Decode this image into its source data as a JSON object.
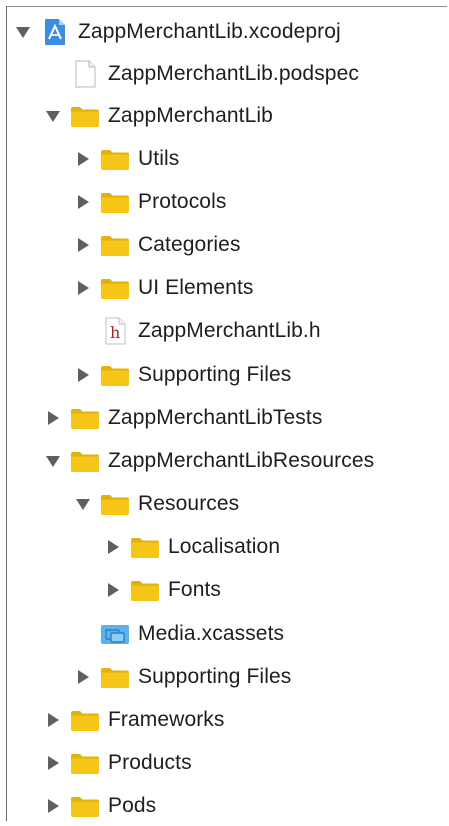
{
  "navigator": {
    "rows": [
      {
        "label": "ZappMerchantLib.xcodeproj",
        "icon": "xcode-project-icon",
        "disclosure": "expanded"
      },
      {
        "label": "ZappMerchantLib.podspec",
        "icon": "document-icon",
        "disclosure": "none"
      },
      {
        "label": "ZappMerchantLib",
        "icon": "folder-icon",
        "disclosure": "expanded"
      },
      {
        "label": "Utils",
        "icon": "folder-icon",
        "disclosure": "collapsed"
      },
      {
        "label": "Protocols",
        "icon": "folder-icon",
        "disclosure": "collapsed"
      },
      {
        "label": "Categories",
        "icon": "folder-icon",
        "disclosure": "collapsed"
      },
      {
        "label": "UI Elements",
        "icon": "folder-icon",
        "disclosure": "collapsed"
      },
      {
        "label": "ZappMerchantLib.h",
        "icon": "header-file-icon",
        "icon_glyph": "h",
        "disclosure": "none"
      },
      {
        "label": "Supporting Files",
        "icon": "folder-icon",
        "disclosure": "collapsed"
      },
      {
        "label": "ZappMerchantLibTests",
        "icon": "folder-icon",
        "disclosure": "collapsed"
      },
      {
        "label": "ZappMerchantLibResources",
        "icon": "folder-icon",
        "disclosure": "expanded"
      },
      {
        "label": "Resources",
        "icon": "folder-icon",
        "disclosure": "expanded"
      },
      {
        "label": "Localisation",
        "icon": "folder-icon",
        "disclosure": "collapsed"
      },
      {
        "label": "Fonts",
        "icon": "folder-icon",
        "disclosure": "collapsed"
      },
      {
        "label": "Media.xcassets",
        "icon": "asset-catalog-icon",
        "disclosure": "none"
      },
      {
        "label": "Supporting Files",
        "icon": "folder-icon",
        "disclosure": "collapsed"
      },
      {
        "label": "Frameworks",
        "icon": "folder-icon",
        "disclosure": "collapsed"
      },
      {
        "label": "Products",
        "icon": "folder-icon",
        "disclosure": "collapsed"
      },
      {
        "label": "Pods",
        "icon": "folder-icon",
        "disclosure": "collapsed"
      }
    ]
  },
  "colors": {
    "folder_fill": "#f5c518",
    "folder_tab": "#e3b10a",
    "disclosure": "#5f5f5f",
    "header_glyph": "#a0281f",
    "asset_blue": "#5ab2ee",
    "project_blue": "#3a8de0"
  }
}
